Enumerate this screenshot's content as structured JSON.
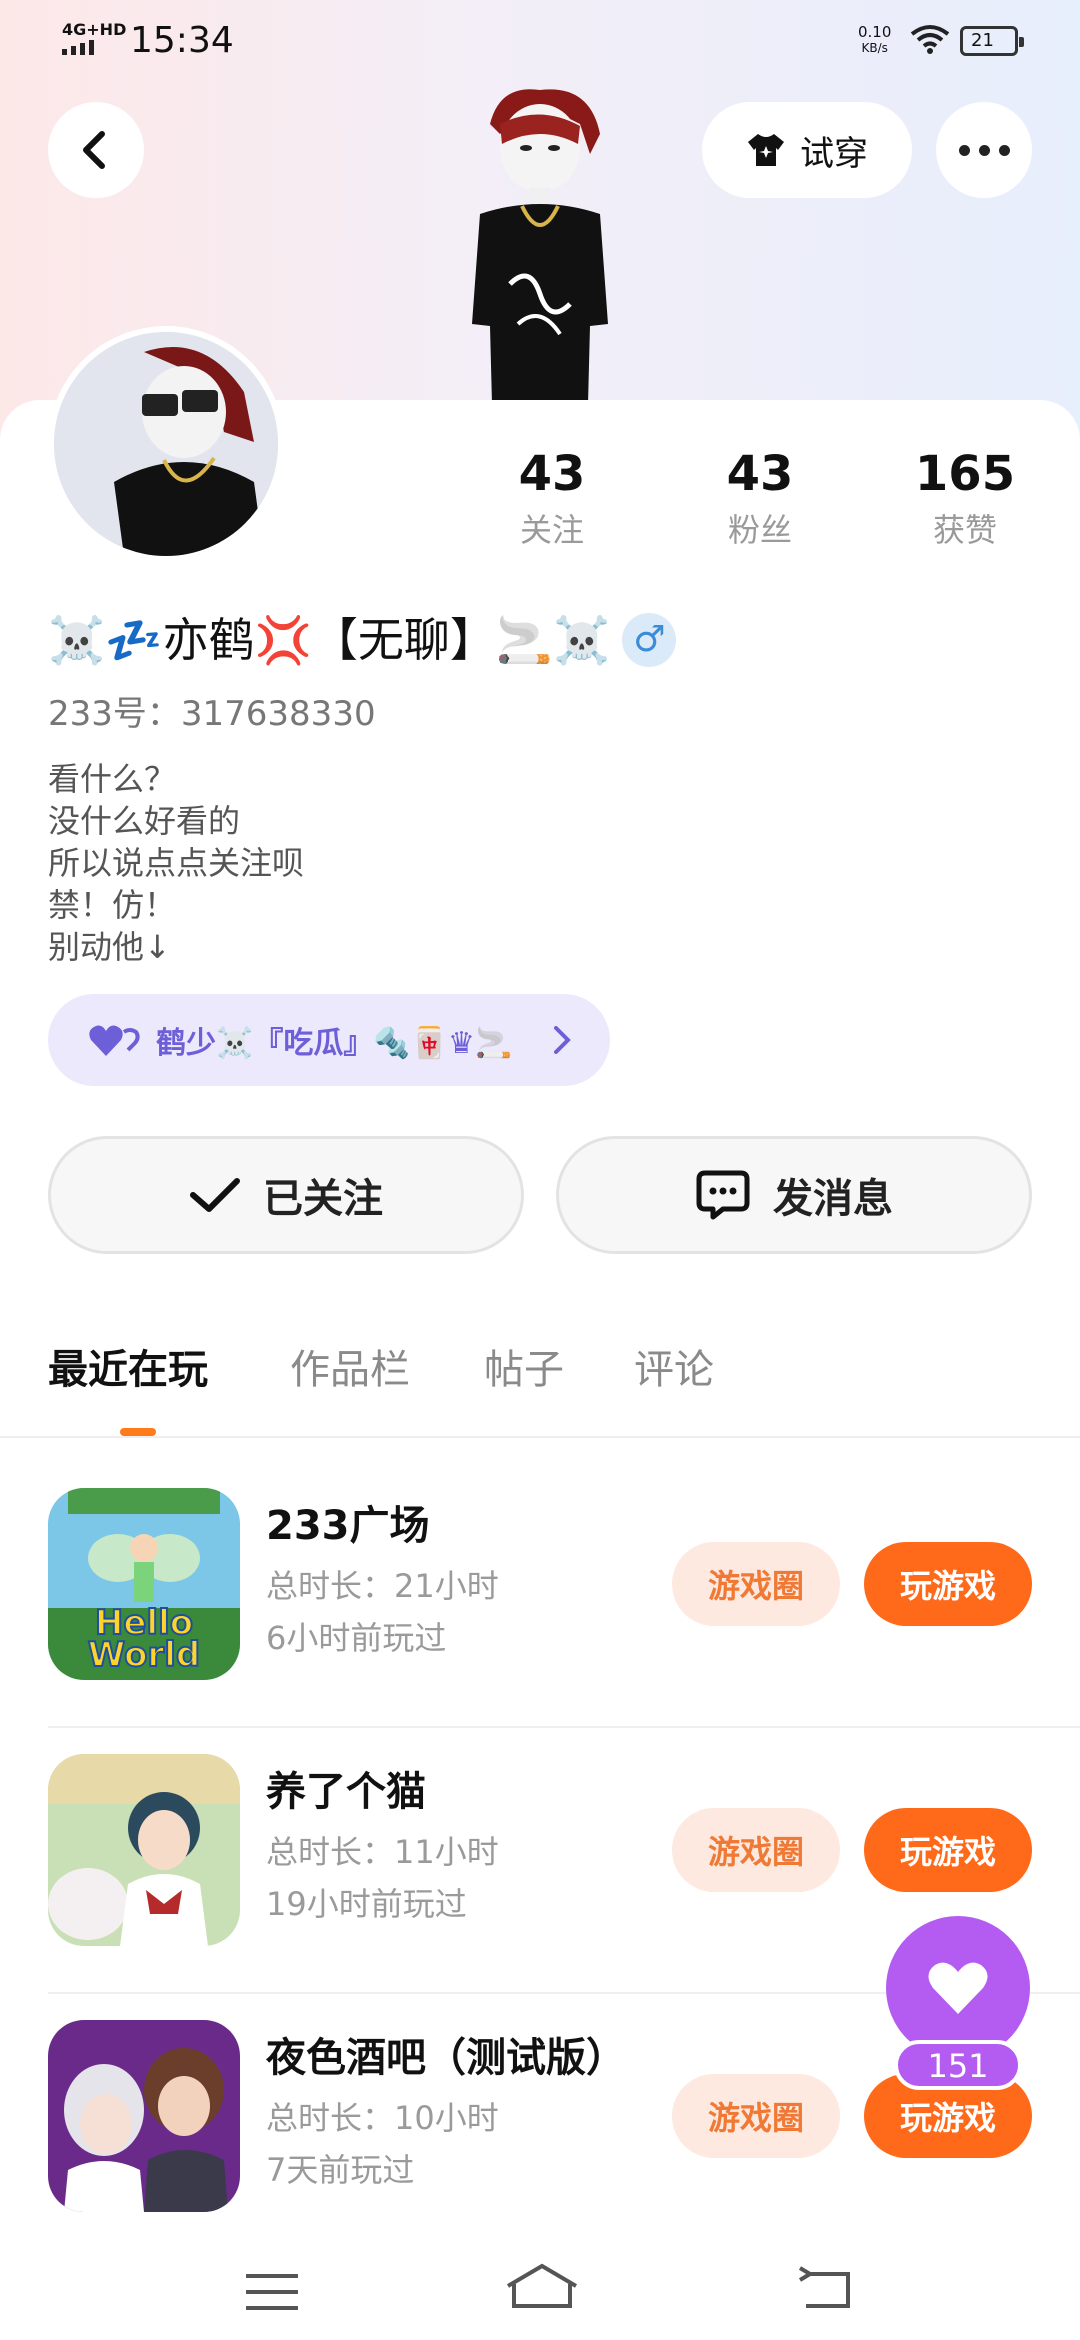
{
  "status_bar": {
    "network": "4G+HD",
    "time": "15:34",
    "speed_value": "0.10",
    "speed_unit": "KB/s",
    "battery": "21"
  },
  "header": {
    "try_on_label": "试穿"
  },
  "profile": {
    "stats": [
      {
        "value": "43",
        "label": "关注"
      },
      {
        "value": "43",
        "label": "粉丝"
      },
      {
        "value": "165",
        "label": "获赞"
      }
    ],
    "nickname_prefix": "☠️💤",
    "nickname_main": "亦鹤💢【无聊】🚬☠️",
    "gender_symbol": "♂",
    "uid": "233号：317638330",
    "bio": [
      "看什么？",
      "没什么好看的",
      "所以说点点关注呗",
      "禁！仿！",
      "别动他↓"
    ],
    "tag_text": "鹤少☠️『吃瓜』🔩🀄♛🚬",
    "follow_label": "已关注",
    "message_label": "发消息"
  },
  "tabs": [
    "最近在玩",
    "作品栏",
    "帖子",
    "评论"
  ],
  "games": [
    {
      "title": "233广场",
      "duration": "总时长：21小时",
      "last_played": "6小时前玩过",
      "icon_text_1": "Hello",
      "icon_text_2": "World",
      "circle_label": "游戏圈",
      "play_label": "玩游戏"
    },
    {
      "title": "养了个猫",
      "duration": "总时长：11小时",
      "last_played": "19小时前玩过",
      "circle_label": "游戏圈",
      "play_label": "玩游戏"
    },
    {
      "title": "夜色酒吧（测试版）",
      "duration": "总时长：10小时",
      "last_played": "7天前玩过",
      "circle_label": "游戏圈",
      "play_label": "玩游戏"
    }
  ],
  "floating": {
    "like_count": "151"
  },
  "colors": {
    "accent_orange": "#ff6a1a",
    "accent_purple": "#b45cf2",
    "tag_text": "#6d5fd8"
  }
}
